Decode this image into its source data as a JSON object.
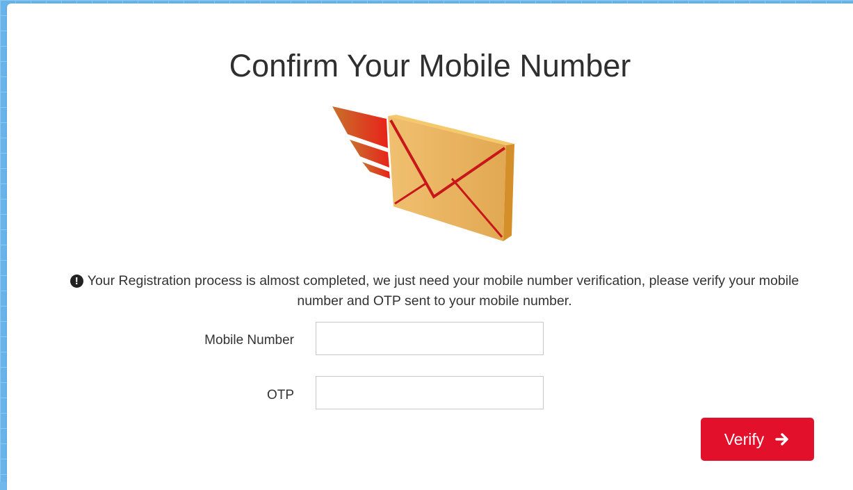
{
  "page": {
    "title": "Confirm Your Mobile Number"
  },
  "notice": {
    "icon": "exclamation-circle-icon",
    "text": "Your Registration process is almost completed, we just need your mobile number verification, please verify your mobile number and OTP sent to your mobile number."
  },
  "form": {
    "mobile_label": "Mobile Number",
    "mobile_value": "",
    "otp_label": "OTP",
    "otp_value": "",
    "verify_label": "Verify",
    "verify_icon": "arrow-right-icon"
  },
  "colors": {
    "accent": "#e2102a",
    "envelope": "#e8b05a"
  }
}
